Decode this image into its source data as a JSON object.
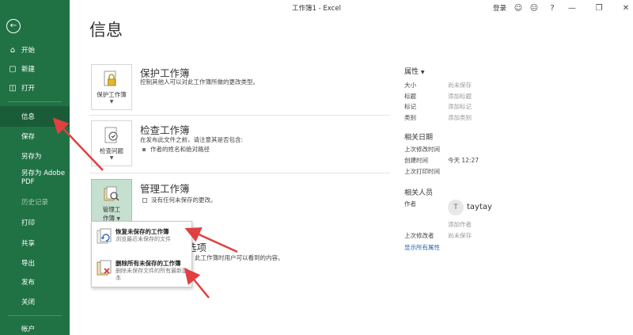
{
  "window": {
    "title": "工作簿1 - Excel",
    "login": "登录",
    "help": "?"
  },
  "sidebar": {
    "back": "back",
    "items": [
      {
        "label": "开始"
      },
      {
        "label": "新建"
      },
      {
        "label": "打开"
      },
      {
        "label": "信息"
      },
      {
        "label": "保存"
      },
      {
        "label": "另存为"
      },
      {
        "label": "另存为 Adobe PDF"
      },
      {
        "label": "历史记录"
      },
      {
        "label": "打印"
      },
      {
        "label": "共享"
      },
      {
        "label": "导出"
      },
      {
        "label": "发布"
      },
      {
        "label": "关闭"
      },
      {
        "label": "帐户"
      }
    ]
  },
  "page": {
    "title": "信息"
  },
  "protect": {
    "button": "保护工作簿",
    "title": "保护工作簿",
    "desc": "控制其他人可以对此工作簿所做的更改类型。"
  },
  "inspect": {
    "button": "检查问题",
    "title": "检查工作簿",
    "desc": "在发布此文件之前，请注意其是否包含:",
    "bullet": "作者的姓名和绝对路径"
  },
  "manage": {
    "button_line1": "管理工",
    "button_line2": "作簿",
    "title": "管理工作簿",
    "desc": "没有任何未保存的更改。",
    "dropdown": [
      {
        "title": "恢复未保存的工作簿",
        "desc": "浏览最近未保存的文件"
      },
      {
        "title": "删除所有未保存的工作簿",
        "desc": "删除未保存文件的所有最新副本"
      }
    ]
  },
  "browser": {
    "title_tail": "选项",
    "desc_tail": "此工作簿时用户可以看到的内容。"
  },
  "properties": {
    "header": "属性",
    "rows": [
      {
        "key": "大小",
        "value": "尚未保存"
      },
      {
        "key": "标题",
        "value": "添加标题"
      },
      {
        "key": "标记",
        "value": "添加标记"
      },
      {
        "key": "类别",
        "value": "添加类别"
      }
    ],
    "dates_header": "相关日期",
    "dates": [
      {
        "key": "上次修改时间",
        "value": ""
      },
      {
        "key": "创建时间",
        "value": "今天 12:27"
      },
      {
        "key": "上次打印时间",
        "value": ""
      }
    ],
    "people_header": "相关人员",
    "author_label": "作者",
    "author_initial": "T",
    "author_name": "taytay",
    "add_author": "添加作者",
    "last_modified_by_label": "上次修改者",
    "last_modified_by_value": "尚未保存",
    "show_all": "显示所有属性"
  },
  "colors": {
    "sidebar": "#207245",
    "sidebar_active": "#1a5c37",
    "arrow": "#e04040",
    "link": "#2a63b5"
  }
}
